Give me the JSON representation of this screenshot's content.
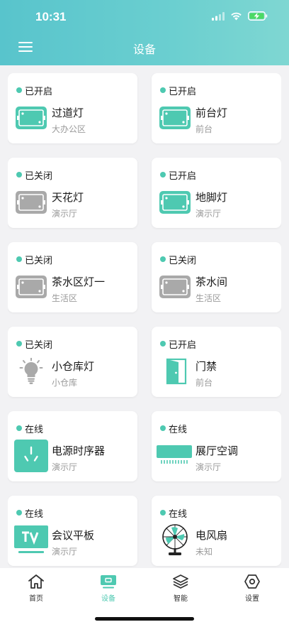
{
  "status_bar": {
    "time": "10:31"
  },
  "header": {
    "title": "设备"
  },
  "colors": {
    "accent": "#4ec9b1",
    "off_gray": "#a9a9a9"
  },
  "devices": [
    {
      "state": "已开启",
      "name": "过道灯",
      "location": "大办公区",
      "icon": "strip-light-on-icon"
    },
    {
      "state": "已开启",
      "name": "前台灯",
      "location": "前台",
      "icon": "strip-light-on-icon"
    },
    {
      "state": "已关闭",
      "name": "天花灯",
      "location": "演示厅",
      "icon": "strip-light-off-icon"
    },
    {
      "state": "已开启",
      "name": "地脚灯",
      "location": "演示厅",
      "icon": "strip-light-on-icon"
    },
    {
      "state": "已关闭",
      "name": "茶水区灯一",
      "location": "生活区",
      "icon": "strip-light-off-icon"
    },
    {
      "state": "已关闭",
      "name": "茶水间",
      "location": "生活区",
      "icon": "strip-light-off-icon"
    },
    {
      "state": "已关闭",
      "name": "小仓库灯",
      "location": "小仓库",
      "icon": "light-bulb-icon"
    },
    {
      "state": "已开启",
      "name": "门禁",
      "location": "前台",
      "icon": "door-icon"
    },
    {
      "state": "在线",
      "name": "电源时序器",
      "location": "演示厅",
      "icon": "power-socket-icon"
    },
    {
      "state": "在线",
      "name": "展厅空调",
      "location": "演示厅",
      "icon": "air-conditioner-icon"
    },
    {
      "state": "在线",
      "name": "会议平板",
      "location": "演示厅",
      "icon": "tv-icon"
    },
    {
      "state": "在线",
      "name": "电风扇",
      "location": "未知",
      "icon": "fan-icon"
    }
  ],
  "tabs": [
    {
      "label": "首页",
      "icon": "home-icon",
      "active": false
    },
    {
      "label": "设备",
      "icon": "device-icon",
      "active": true
    },
    {
      "label": "智能",
      "icon": "layers-icon",
      "active": false
    },
    {
      "label": "设置",
      "icon": "hexagon-settings-icon",
      "active": false
    }
  ]
}
